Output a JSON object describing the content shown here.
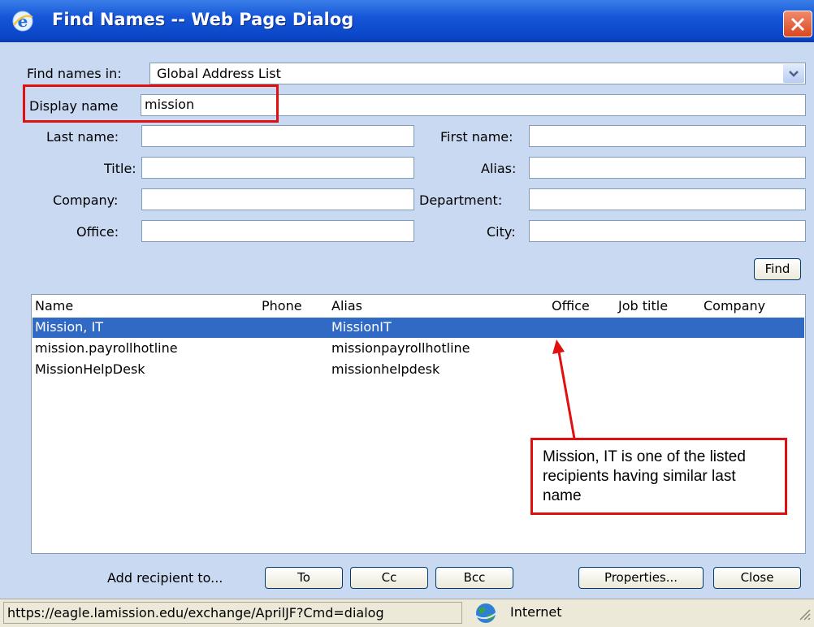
{
  "window": {
    "title": "Find Names -- Web Page Dialog",
    "accent": "#0a44c6",
    "icon": "ie-icon"
  },
  "form": {
    "find_in_label": "Find names in:",
    "find_in_value": "Global Address List",
    "display_name_label": "Display name",
    "display_name_value": "mission",
    "last_name_label": "Last name:",
    "first_name_label": "First name:",
    "title_label": "Title:",
    "alias_label": "Alias:",
    "company_label": "Company:",
    "department_label": "Department:",
    "office_label": "Office:",
    "city_label": "City:",
    "find_button": "Find"
  },
  "results": {
    "columns": [
      "Name",
      "Phone",
      "Alias",
      "Office",
      "Job title",
      "Company"
    ],
    "rows": [
      {
        "name": "Mission, IT",
        "alias": "MissionIT",
        "selected": true
      },
      {
        "name": "mission.payrollhotline",
        "alias": "missionpayrollhotline",
        "selected": false
      },
      {
        "name": "MissionHelpDesk",
        "alias": "missionhelpdesk",
        "selected": false
      }
    ],
    "selection_color": "#316ac5"
  },
  "annotation": {
    "text": "Mission, IT is one of the listed recipients having similar last name",
    "color": "#e01010"
  },
  "actions": {
    "add_label": "Add recipient to...",
    "to": "To",
    "cc": "Cc",
    "bcc": "Bcc",
    "properties": "Properties...",
    "close": "Close"
  },
  "status": {
    "url": "https://eagle.lamission.edu/exchange/AprilJF?Cmd=dialog",
    "zone": "Internet",
    "zone_icon": "globe-icon"
  }
}
